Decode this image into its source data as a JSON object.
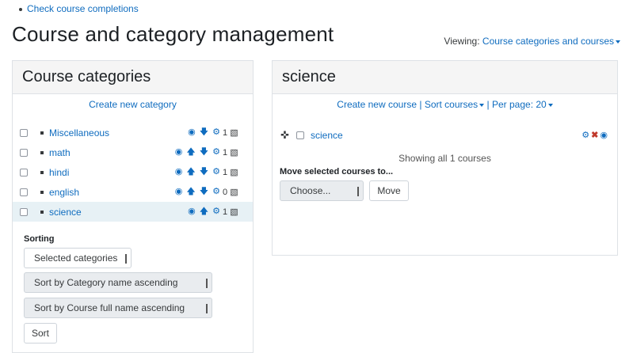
{
  "top_link": "Check course completions",
  "page_title": "Course and category management",
  "viewing": {
    "label": "Viewing:",
    "value": "Course categories and courses"
  },
  "categories_panel": {
    "title": "Course categories",
    "create_link": "Create new category",
    "rows": [
      {
        "name": "Miscellaneous",
        "actions": "👁 ↓ ⚙",
        "count": "1"
      },
      {
        "name": "math",
        "actions": "👁 ↑ ↓ ⚙",
        "count": "1"
      },
      {
        "name": "hindi",
        "actions": "👁 ↑ ↓ ⚙",
        "count": "1"
      },
      {
        "name": "english",
        "actions": "👁 ↑ ↓ ⚙",
        "count": "0"
      },
      {
        "name": "science",
        "actions": "👁 ↑ ⚙",
        "count": "1",
        "active": true
      }
    ],
    "sorting_label": "Sorting",
    "sort_scope_select": "Selected categories",
    "sort_category_select": "Sort by Category name ascending",
    "sort_course_select": "Sort by Course full name ascending",
    "sort_button": "Sort"
  },
  "courses_panel": {
    "title": "science",
    "create_course_link": "Create new course",
    "separator1": "|",
    "sort_courses_link": "Sort courses",
    "separator2": "|",
    "per_page_link": "Per page: 20",
    "course_rows": [
      {
        "name": "science"
      }
    ],
    "showing_text": "Showing all 1 courses",
    "move_label": "Move selected courses to...",
    "move_select": "Choose...",
    "move_button": "Move"
  },
  "colors": {
    "link": "#0f6cbf",
    "header_bg": "#f5f5f5",
    "active_row": "#e7f1f5",
    "delete": "#c0392b"
  }
}
